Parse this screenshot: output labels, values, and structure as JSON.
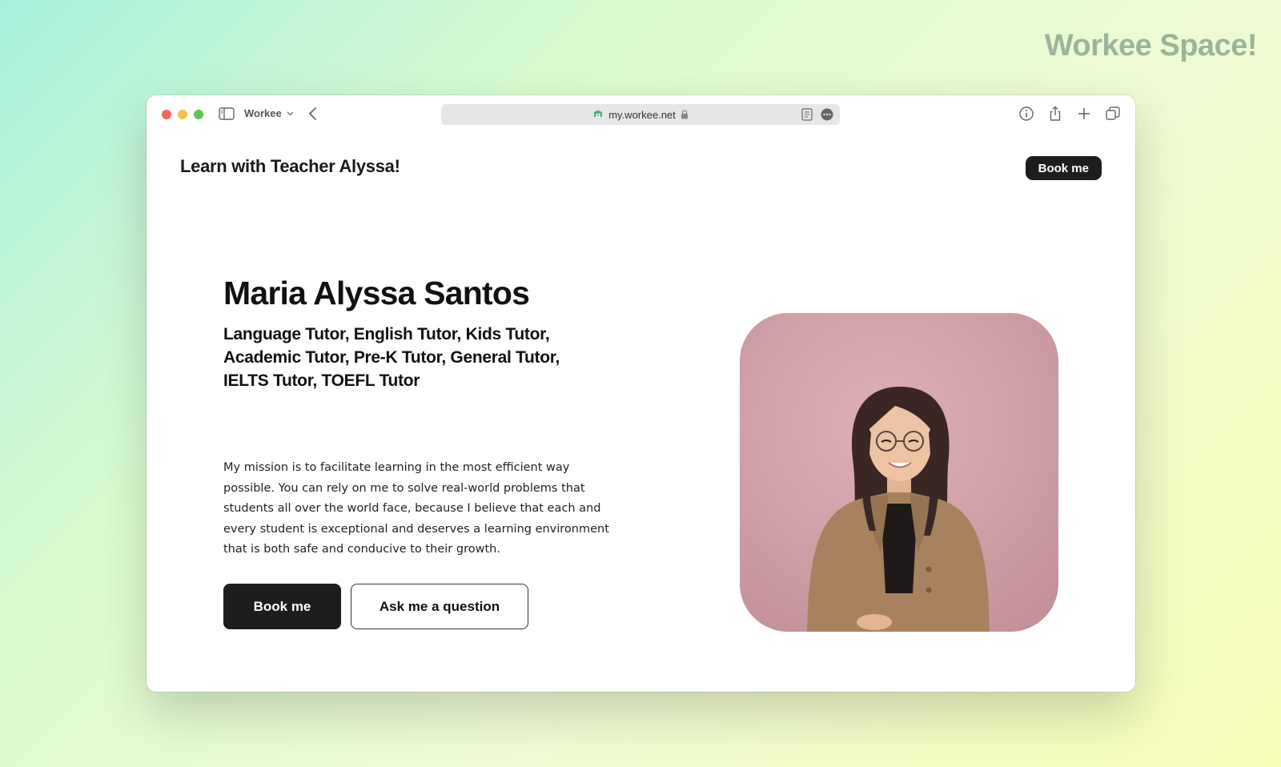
{
  "watermark": "Workee Space!",
  "browser": {
    "tab_name": "Workee",
    "url": "my.workee.net"
  },
  "site": {
    "title": "Learn with Teacher Alyssa!",
    "nav_book_label": "Book me"
  },
  "hero": {
    "name": "Maria Alyssa Santos",
    "subtitle": "Language Tutor, English Tutor, Kids Tutor, Academic Tutor, Pre-K Tutor, General Tutor, IELTS Tutor, TOEFL Tutor",
    "description": "My mission is to facilitate learning in the most efficient way possible. You can rely on me to solve real-world problems that students all over the world face, because I believe that each and every student is exceptional and deserves a learning environment that is both safe and conducive to their growth.",
    "book_label": "Book me",
    "question_label": "Ask me a question"
  },
  "colors": {
    "accent_dark": "#1d1d1d",
    "photo_background": "#d4a6ad",
    "watermark": "#9ab59a"
  },
  "icons": [
    "sidebar-icon",
    "chevron-down-icon",
    "back-chevron-icon",
    "site-shield-icon",
    "lock-icon",
    "reader-icon",
    "more-icon",
    "info-icon",
    "share-icon",
    "plus-icon",
    "tabs-icon"
  ]
}
